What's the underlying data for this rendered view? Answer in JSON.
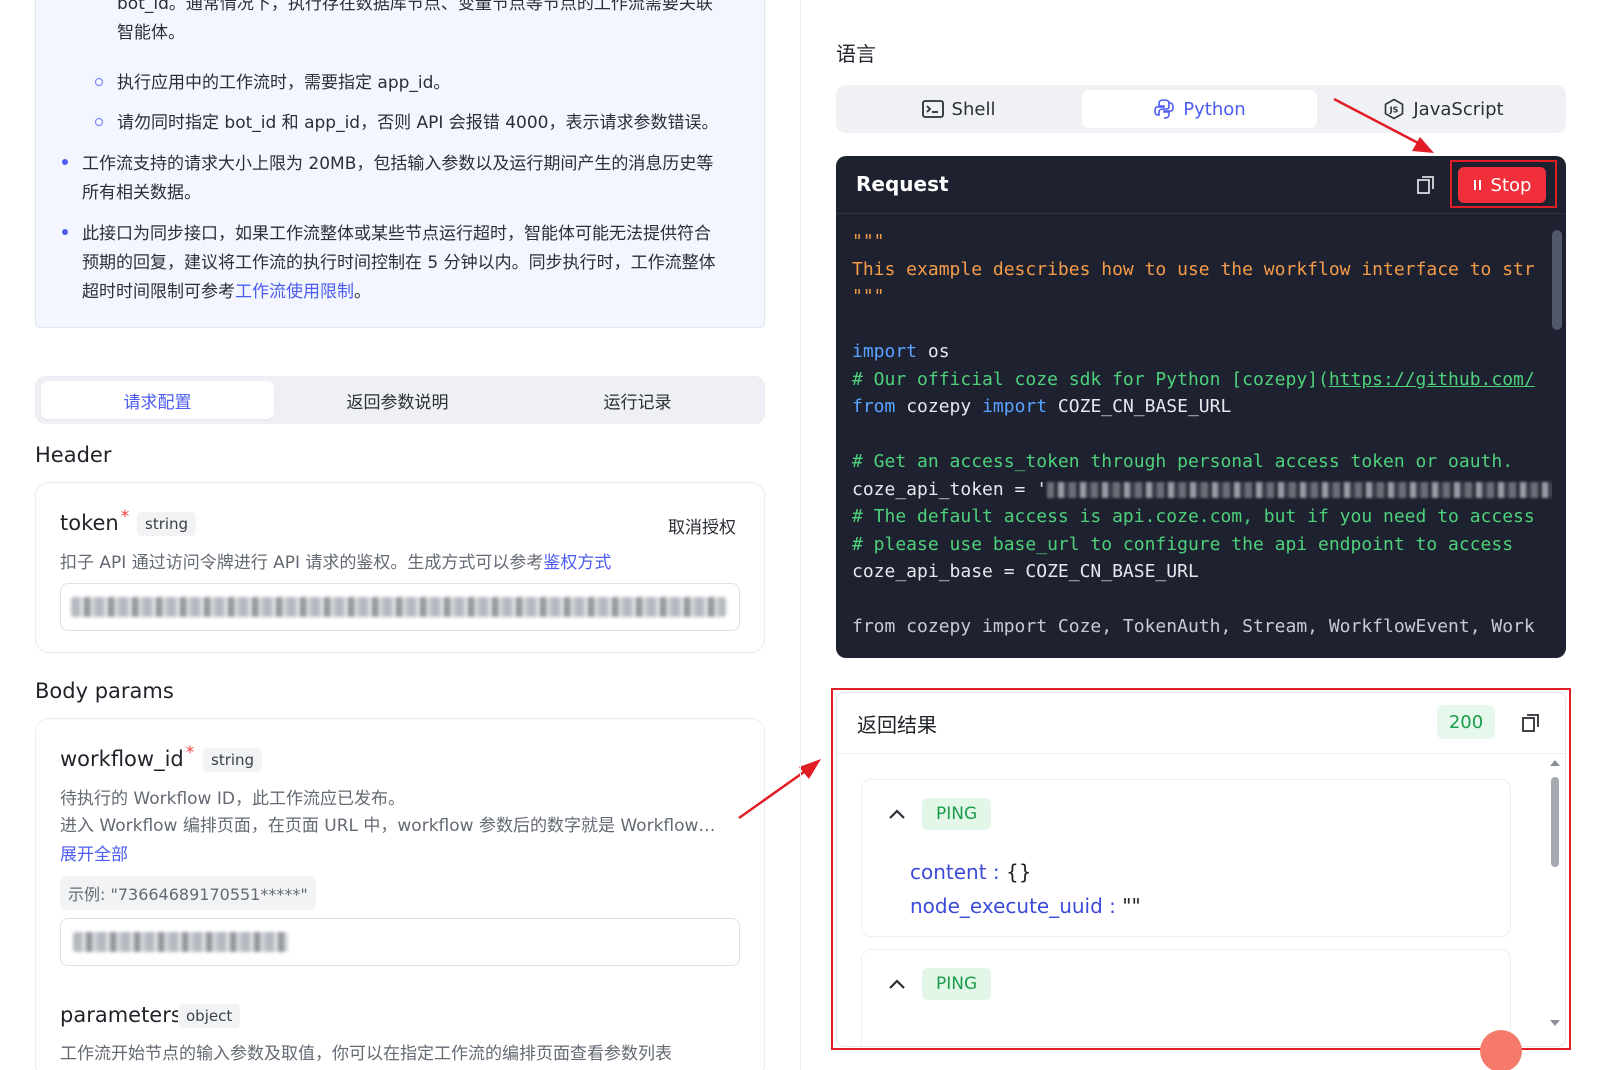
{
  "notes": {
    "line1": "bot_id。通常情况下，执行存在数据库节点、变量节点等节点的工作流需要关联",
    "line2": "智能体。",
    "line3": "执行应用中的工作流时，需要指定 app_id。",
    "line4": "请勿同时指定 bot_id 和 app_id，否则 API 会报错 4000，表示请求参数错误。",
    "line5": "工作流支持的请求大小上限为 20MB，包括输入参数以及运行期间产生的消息历史等",
    "line6": "所有相关数据。",
    "line7": "此接口为同步接口，如果工作流整体或某些节点运行超时，智能体可能无法提供符合",
    "line8": "预期的回复，建议将工作流的执行时间控制在 5 分钟以内。同步执行时，工作流整体",
    "line9_prefix": "超时时间限制可参考",
    "line9_link": "工作流使用限制",
    "line9_suffix": "。"
  },
  "tabs": [
    "请求配置",
    "返回参数说明",
    "运行记录"
  ],
  "header_section": {
    "title": "Header",
    "token": {
      "name": "token",
      "required_mark": "*",
      "type": "string",
      "action": "取消授权",
      "desc_prefix": "扣子 API 通过访问令牌进行 API 请求的鉴权。生成方式可以参考",
      "desc_link": "鉴权方式"
    }
  },
  "body_section": {
    "title": "Body params",
    "workflow_id": {
      "name": "workflow_id",
      "required_mark": "*",
      "type": "string",
      "desc1": "待执行的 Workflow ID，此工作流应已发布。",
      "desc2": "进入 Workflow 编排页面，在页面 URL 中，workflow 参数后的数字就是 Workflow…",
      "expand": "展开全部",
      "example": "示例: \"73664689170551*****\""
    },
    "parameters": {
      "name": "parameters",
      "type": "object",
      "desc": "工作流开始节点的输入参数及取值，你可以在指定工作流的编排页面查看参数列表"
    }
  },
  "language": {
    "label": "语言",
    "options": [
      "Shell",
      "Python",
      "JavaScript"
    ],
    "selected": "Python"
  },
  "request_panel": {
    "title": "Request",
    "stop_label": "Stop",
    "code": {
      "l1": "\"\"\"",
      "l2": "This example describes how to use the workflow interface to str",
      "l3": "\"\"\"",
      "l5_kw": "import",
      "l5_rest": " os",
      "l6_cmt": "# Our official coze sdk for Python [cozepy](",
      "l6_url": "https://github.com/",
      "l7_kw1": "from",
      "l7_mid": " cozepy ",
      "l7_kw2": "import",
      "l7_rest": " COZE_CN_BASE_URL",
      "l9": "# Get an access_token through personal access token or oauth.",
      "l10": "coze_api_token = '",
      "l11": "# The default access is api.coze.com, but if you need to access",
      "l12": "# please use base_url to configure the api endpoint to access",
      "l13": "coze_api_base = COZE_CN_BASE_URL",
      "l15": "from cozepy import Coze, TokenAuth, Stream, WorkflowEvent, Work"
    }
  },
  "result_panel": {
    "title": "返回结果",
    "status_code": "200",
    "events": [
      {
        "event": "PING",
        "fields": [
          {
            "key": "content",
            "value": "{}"
          },
          {
            "key": "node_execute_uuid",
            "value": "\"\""
          }
        ]
      },
      {
        "event": "PING",
        "fields": []
      }
    ]
  },
  "colors": {
    "accent": "#4c5cf0",
    "highlight_red": "#e11d26",
    "code_bg": "#1e2130",
    "success_green": "#1a9c4a"
  }
}
